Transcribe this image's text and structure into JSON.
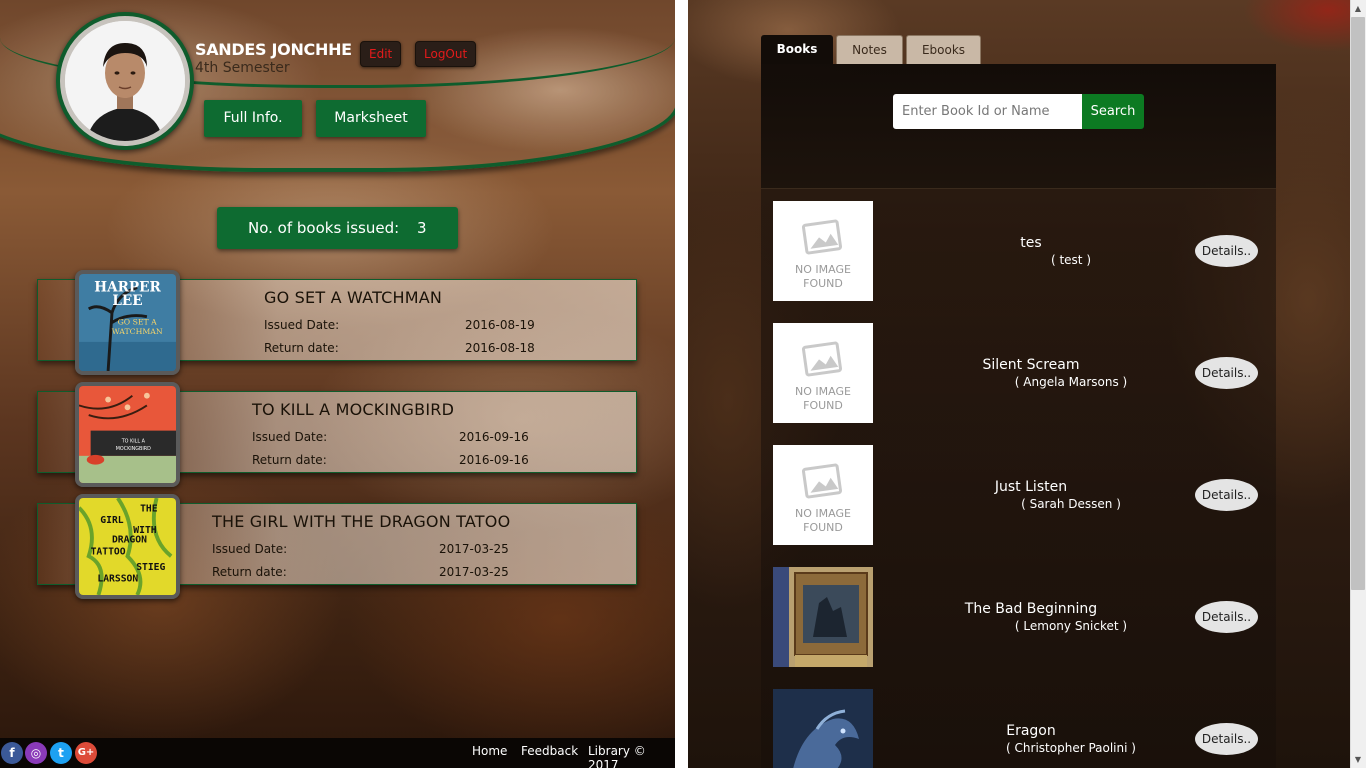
{
  "profile": {
    "name": "SANDES JONCHHE",
    "semester": "4th Semester",
    "edit_label": "Edit",
    "logout_label": "LogOut",
    "full_info_label": "Full Info.",
    "marksheet_label": "Marksheet"
  },
  "issued": {
    "label": "No. of books issued:",
    "count": "3"
  },
  "issued_books": [
    {
      "title": "GO SET A WATCHMAN",
      "issued_label": "Issued Date:",
      "issued_date": "2016-08-19",
      "return_label": "Return date:",
      "return_date": "2016-08-18"
    },
    {
      "title": "TO KILL A MOCKINGBIRD",
      "issued_label": "Issued Date:",
      "issued_date": "2016-09-16",
      "return_label": "Return date:",
      "return_date": "2016-09-16"
    },
    {
      "title": "THE GIRL WITH THE DRAGON TATOO",
      "issued_label": "Issued Date:",
      "issued_date": "2017-03-25",
      "return_label": "Return date:",
      "return_date": "2017-03-25"
    }
  ],
  "footer": {
    "social": [
      "facebook-icon",
      "instagram-icon",
      "twitter-icon",
      "google-plus-icon"
    ],
    "links": [
      "Home",
      "Feedback",
      "Library © 2017"
    ]
  },
  "tabs": [
    "Books",
    "Notes",
    "Ebooks"
  ],
  "search": {
    "placeholder": "Enter Book Id or Name",
    "button_label": "Search"
  },
  "book_list": [
    {
      "title": "tes",
      "author": "( test )",
      "details_label": "Details..",
      "thumb": "no-image"
    },
    {
      "title": "Silent Scream",
      "author": "( Angela Marsons )",
      "details_label": "Details..",
      "thumb": "no-image"
    },
    {
      "title": "Just Listen",
      "author": "( Sarah Dessen )",
      "details_label": "Details..",
      "thumb": "no-image"
    },
    {
      "title": "The Bad Beginning",
      "author": "( Lemony Snicket )",
      "details_label": "Details..",
      "thumb": "cover"
    },
    {
      "title": "Eragon",
      "author": "( Christopher Paolini )",
      "details_label": "Details..",
      "thumb": "cover"
    }
  ],
  "no_image_text": [
    "NO IMAGE",
    "FOUND"
  ],
  "colors": {
    "accent_green": "#0e6b31",
    "search_green": "#0c7a22",
    "danger_red": "#e31b1b"
  }
}
